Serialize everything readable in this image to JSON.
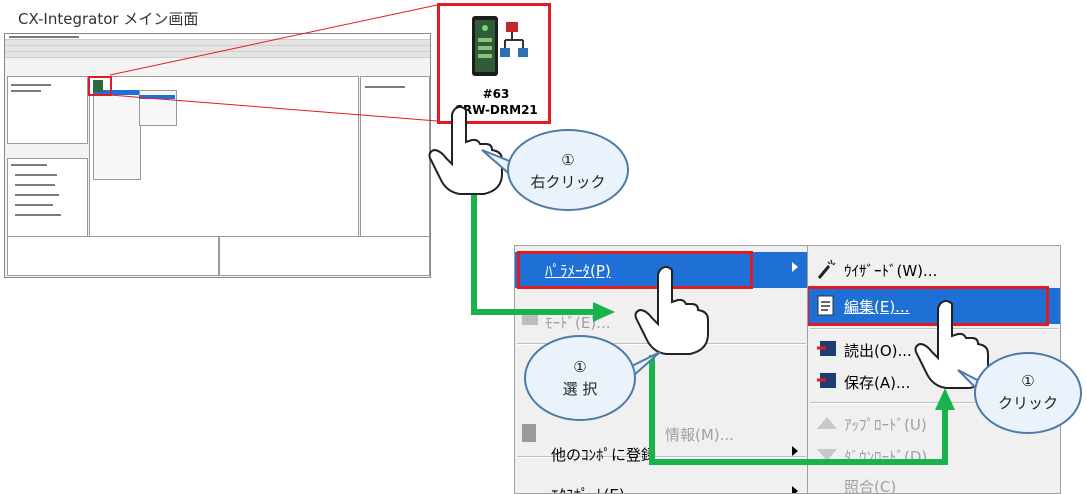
{
  "caption": "CX-Integrator メイン画面",
  "device": {
    "number": "#63",
    "model": "CRW-DRM21"
  },
  "menu_main": {
    "items": [
      {
        "label": "ﾊﾟﾗﾒｰﾀ(P)",
        "state": "highlighted",
        "submenu": true
      },
      {
        "label": "ﾓｰﾄﾞ(E)...",
        "state": "disabled"
      },
      {
        "label": "",
        "state": "separator"
      },
      {
        "label": "",
        "state": "blank"
      },
      {
        "label": "情報(M)...",
        "state": "disabled"
      },
      {
        "label": "他のｺﾝﾎﾟに登録",
        "state": "enabled",
        "submenu": true
      },
      {
        "label": "ｴｸｽﾎﾟｰﾄ(E)",
        "state": "enabled",
        "submenu": true
      }
    ]
  },
  "menu_sub": {
    "items": [
      {
        "label": "ｳｲｻﾞｰﾄﾞ(W)...",
        "icon": "wizard-icon",
        "state": "enabled"
      },
      {
        "label": "編集(E)...",
        "icon": "edit-icon",
        "state": "highlighted"
      },
      {
        "label": "読出(O)...",
        "icon": "upload-read-icon",
        "state": "enabled"
      },
      {
        "label": "保存(A)...",
        "icon": "save-icon",
        "state": "enabled"
      },
      {
        "label": "ｱｯﾌﾟﾛｰﾄﾞ(U)",
        "icon": "upload-icon",
        "state": "disabled"
      },
      {
        "label": "ﾀﾞｳﾝﾛｰﾄﾞ(D)",
        "icon": "download-icon",
        "state": "disabled"
      },
      {
        "label": "照合(C)",
        "icon": "",
        "state": "disabled"
      }
    ]
  },
  "callouts": {
    "right_click": {
      "num": "①",
      "text": "右クリック"
    },
    "select": {
      "num": "①",
      "text": "選 択"
    },
    "click": {
      "num": "①",
      "text": "クリック"
    }
  },
  "colors": {
    "highlight": "#1e70d6",
    "frame": "#e21a23",
    "arrow": "#19b24b",
    "bubble_border": "#4f7aa6"
  }
}
